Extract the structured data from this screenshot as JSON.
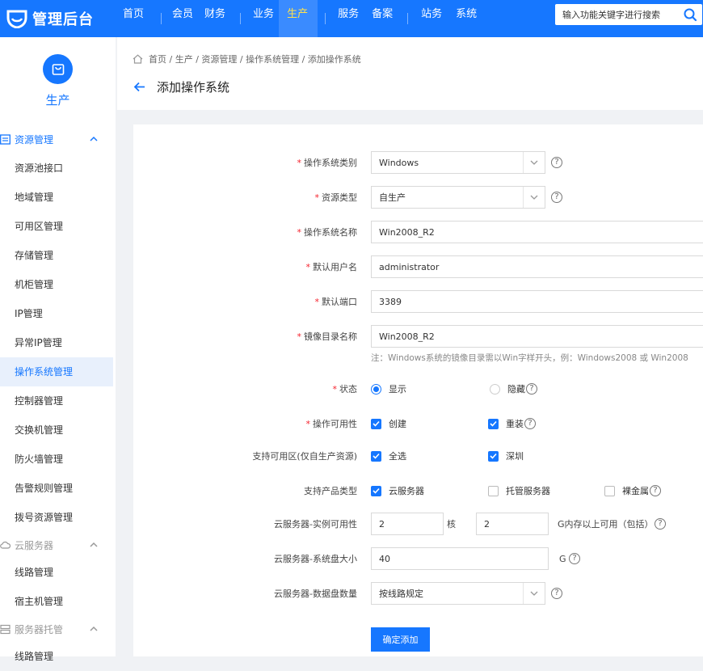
{
  "header": {
    "logo_text": "管理后台",
    "nav": [
      "首页",
      "会员",
      "财务",
      "业务",
      "生产",
      "服务",
      "备案",
      "站务",
      "系统"
    ],
    "active_nav": "生产",
    "search_placeholder": "输入功能关键字进行搜索",
    "brand_color": "#1677ff",
    "active_text_color": "#ffe14d"
  },
  "sidebar": {
    "title": "生产",
    "groups": [
      {
        "label": "资源管理",
        "state": "open",
        "items": [
          "资源池接口",
          "地域管理",
          "可用区管理",
          "存储管理",
          "机柜管理",
          "IP管理",
          "异常IP管理",
          "操作系统管理",
          "控制器管理",
          "交换机管理",
          "防火墙管理",
          "告警规则管理",
          "拨号资源管理"
        ]
      },
      {
        "label": "云服务器",
        "state": "closed",
        "items": [
          "线路管理",
          "宿主机管理"
        ]
      },
      {
        "label": "服务器托管",
        "state": "closed",
        "items": [
          "线路管理"
        ]
      }
    ],
    "active_item": "操作系统管理"
  },
  "breadcrumb": [
    "首页",
    "生产",
    "资源管理",
    "操作系统管理",
    "添加操作系统"
  ],
  "page_title": "添加操作系统",
  "form": {
    "os_type": {
      "label": "操作系统类别",
      "value": "Windows",
      "required": true
    },
    "resource_type": {
      "label": "资源类型",
      "value": "自生产",
      "required": true
    },
    "os_name": {
      "label": "操作系统名称",
      "value": "Win2008_R2",
      "required": true
    },
    "default_user": {
      "label": "默认用户名",
      "value": "administrator",
      "required": true
    },
    "default_port": {
      "label": "默认端口",
      "value": "3389",
      "required": true
    },
    "image_dir": {
      "label": "镜像目录名称",
      "value": "Win2008_R2",
      "required": true,
      "hint": "注：Windows系统的镜像目录需以Win字样开头，例：Windows2008 或 Win2008"
    },
    "status": {
      "label": "状态",
      "required": true,
      "options": [
        {
          "label": "显示",
          "checked": true
        },
        {
          "label": "隐藏",
          "checked": false
        }
      ]
    },
    "operation": {
      "label": "操作可用性",
      "required": true,
      "options": [
        {
          "label": "创建",
          "checked": true
        },
        {
          "label": "重装",
          "checked": true
        }
      ]
    },
    "zones": {
      "label": "支持可用区(仅自生产资源)",
      "required": false,
      "options": [
        {
          "label": "全选",
          "checked": true
        },
        {
          "label": "深圳",
          "checked": true
        }
      ]
    },
    "products": {
      "label": "支持产品类型",
      "required": false,
      "options": [
        {
          "label": "云服务器",
          "checked": true
        },
        {
          "label": "托管服务器",
          "checked": false
        },
        {
          "label": "裸金属",
          "checked": false
        }
      ]
    },
    "instance": {
      "label": "云服务器-实例可用性",
      "required": false,
      "cores": "2",
      "cores_unit": "核",
      "memory": "2",
      "memory_unit": "G内存以上可用（包括）"
    },
    "sys_disk": {
      "label": "云服务器-系统盘大小",
      "required": false,
      "value": "40",
      "unit": "G"
    },
    "data_disk": {
      "label": "云服务器-数据盘数量",
      "required": false,
      "value": "按线路规定"
    },
    "help_glyph": "?",
    "submit_label": "确定添加"
  }
}
